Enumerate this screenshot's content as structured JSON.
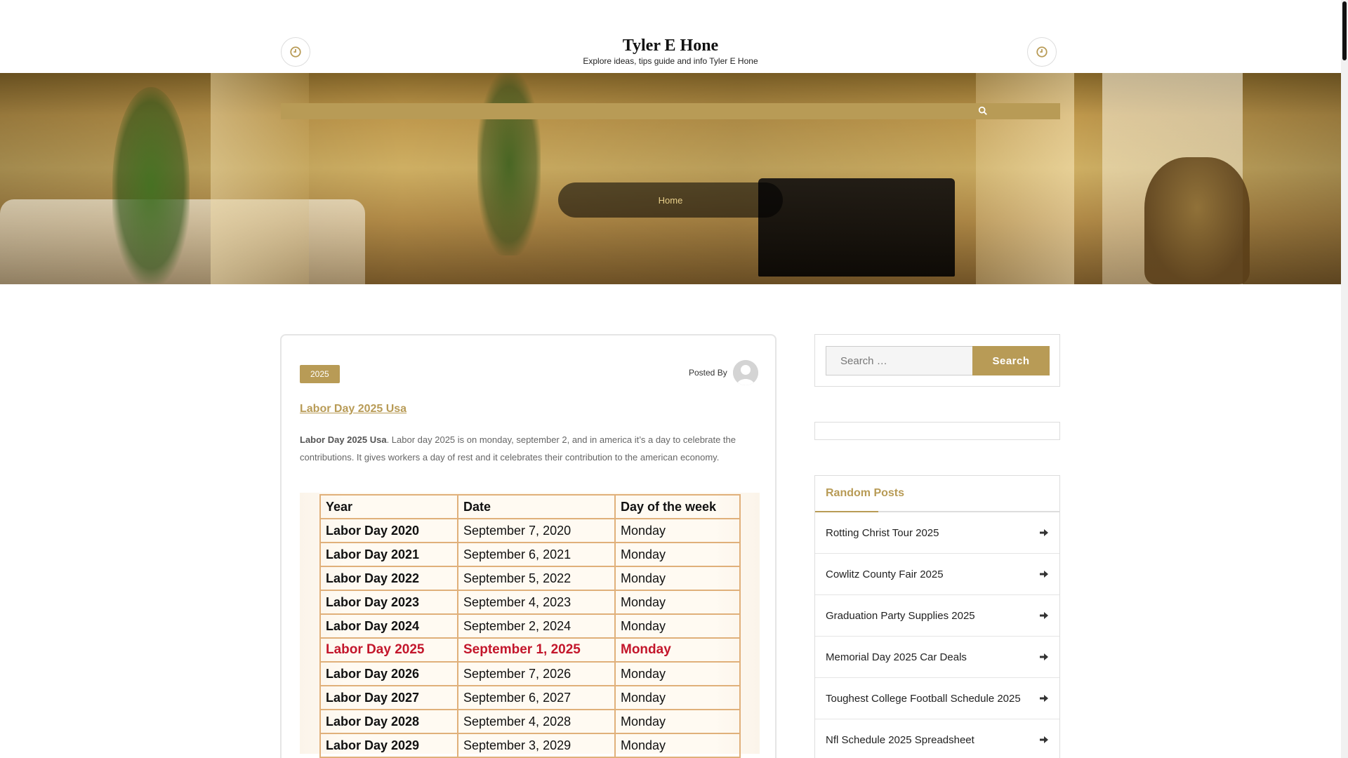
{
  "header": {
    "site_title": "Tyler E Hone",
    "site_description": "Explore ideas, tips guide and info Tyler E Hone",
    "left_icon": "clock-icon",
    "right_icon": "clock-icon"
  },
  "nav": {
    "search_icon": "search-icon"
  },
  "breadcrumb": {
    "home": "Home"
  },
  "post": {
    "category": "2025",
    "posted_by": "Posted By",
    "title": "Labor Day 2025 Usa",
    "excerpt_bold": "Labor Day 2025 Usa",
    "excerpt_text": ". Labor day 2025 is on monday, september 2, and in america it’s a day to celebrate the contributions. It gives workers a day of rest and it celebrates their contribution to the american economy.",
    "table": {
      "headers": [
        "Year",
        "Date",
        "Day of the week"
      ],
      "rows": [
        [
          "Labor Day 2020",
          "September 7, 2020",
          "Monday"
        ],
        [
          "Labor Day 2021",
          "September 6, 2021",
          "Monday"
        ],
        [
          "Labor Day 2022",
          "September 5, 2022",
          "Monday"
        ],
        [
          "Labor Day 2023",
          "September 4, 2023",
          "Monday"
        ],
        [
          "Labor Day 2024",
          "September 2, 2024",
          "Monday"
        ],
        [
          "Labor Day 2025",
          "September 1, 2025",
          "Monday"
        ],
        [
          "Labor Day 2026",
          "September 7, 2026",
          "Monday"
        ],
        [
          "Labor Day 2027",
          "September 6, 2027",
          "Monday"
        ],
        [
          "Labor Day 2028",
          "September 4, 2028",
          "Monday"
        ],
        [
          "Labor Day 2029",
          "September 3, 2029",
          "Monday"
        ]
      ],
      "highlight_color": "#c3162b"
    }
  },
  "sidebar": {
    "search": {
      "placeholder": "Search …",
      "button": "Search"
    },
    "random_posts": {
      "title": "Random Posts",
      "items": [
        "Rotting Christ Tour 2025",
        "Cowlitz County Fair 2025",
        "Graduation Party Supplies 2025",
        "Memorial Day 2025 Car Deals",
        "Toughest College Football Schedule 2025",
        "Nfl Schedule 2025 Spreadsheet"
      ]
    }
  },
  "colors": {
    "accent": "#b89b56"
  }
}
